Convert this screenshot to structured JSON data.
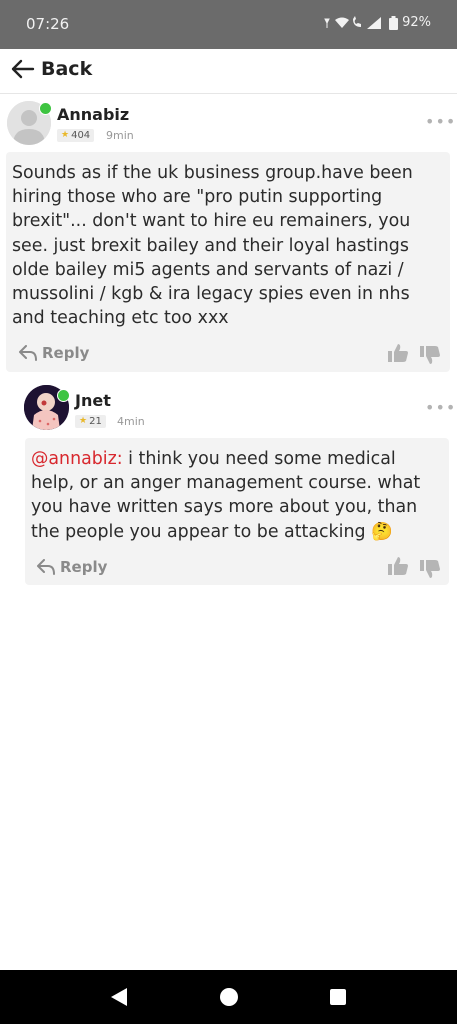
{
  "status_bar": {
    "time": "07:26",
    "battery": "92%"
  },
  "header": {
    "back_label": "Back"
  },
  "comments": [
    {
      "username": "Annabiz",
      "badge": "404",
      "time": "9min",
      "text": "Sounds as if the uk business group.have been hiring those who are \"pro putin supporting brexit\"... don't want to hire eu remainers, you see. just brexit bailey and their loyal hastings olde bailey mi5 agents and servants of nazi / mussolini / kgb & ira legacy spies even in nhs and teaching etc too xxx",
      "reply_label": "Reply"
    },
    {
      "username": "Jnet",
      "badge": "21",
      "time": "4min",
      "mention": "@annabiz:",
      "text": " i think you need some medical help, or an anger management course. what you have written says more about you, than the people you appear to be attacking",
      "emoji": "🤔",
      "reply_label": "Reply"
    }
  ],
  "icons": {
    "more": "more-options-icon",
    "reply": "reply-arrow-icon",
    "like": "thumbs-up-icon",
    "dislike": "thumbs-down-icon"
  },
  "colors": {
    "mention": "#d8282e",
    "online": "#3ec441",
    "star": "#e9b82a"
  }
}
